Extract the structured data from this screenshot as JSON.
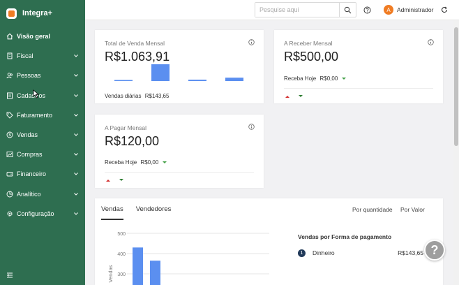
{
  "brand": {
    "name": "Integra+"
  },
  "sidebar": {
    "items": [
      {
        "label": "Visão geral",
        "icon": "home-icon"
      },
      {
        "label": "Fiscal",
        "icon": "document-icon"
      },
      {
        "label": "Pessoas",
        "icon": "people-icon"
      },
      {
        "label": "Cadastros",
        "icon": "register-icon"
      },
      {
        "label": "Faturamento",
        "icon": "tag-icon"
      },
      {
        "label": "Vendas",
        "icon": "money-icon"
      },
      {
        "label": "Compras",
        "icon": "chart-icon"
      },
      {
        "label": "Financeiro",
        "icon": "wallet-icon"
      },
      {
        "label": "Analítico",
        "icon": "analytics-icon"
      },
      {
        "label": "Configuração",
        "icon": "gear-icon"
      }
    ]
  },
  "topbar": {
    "search_placeholder": "Pesquise aqui",
    "user_initial": "A",
    "user_name": "Administrador"
  },
  "cards": {
    "vendas": {
      "title": "Total de Venda Mensal",
      "value": "R$1.063,91",
      "sub_label": "Vendas diárias",
      "sub_value": "R$143,65",
      "bars": [
        0.05,
        1.0,
        0.08,
        0.2
      ]
    },
    "receber": {
      "title": "A Receber Mensal",
      "value": "R$500,00",
      "sub_label": "Receba Hoje",
      "sub_value": "R$0,00"
    },
    "pagar": {
      "title": "A Pagar Mensal",
      "value": "R$120,00",
      "sub_label": "Receba Hoje",
      "sub_value": "R$0,00"
    }
  },
  "sales": {
    "tabs": [
      "Vendas",
      "Vendedores"
    ],
    "toggles": [
      "Por quantidade",
      "Por Valor"
    ],
    "payment_title": "Vendas por Forma de pagamento",
    "payments": [
      {
        "num": "1",
        "name": "Dinheiro",
        "value": "R$143,65"
      }
    ]
  },
  "chart_data": {
    "type": "bar",
    "ylabel": "Vendas",
    "ylim": [
      250,
      500
    ],
    "yticks": [
      "500",
      "400",
      "300"
    ],
    "values": [
      430,
      365
    ],
    "color": "#5b8ff0"
  },
  "help_fab": "?"
}
